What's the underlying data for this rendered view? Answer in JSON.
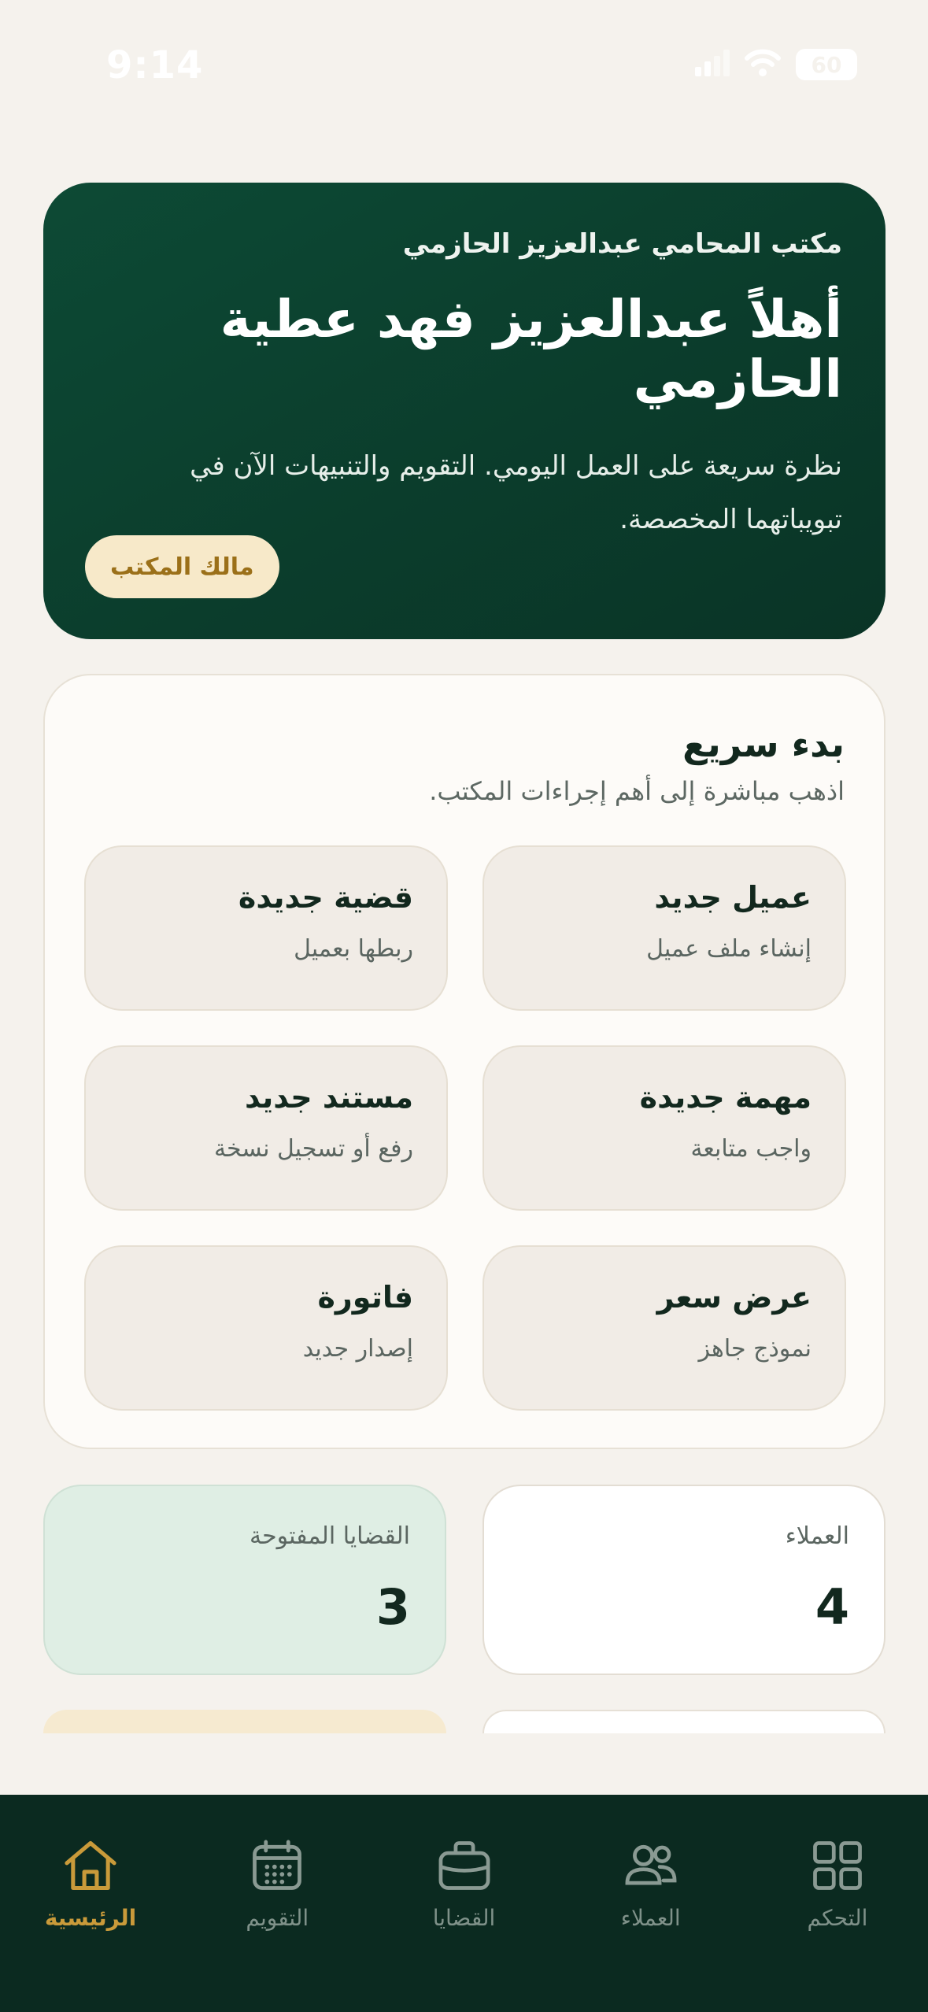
{
  "status_bar": {
    "time": "9:14",
    "battery": "60"
  },
  "hero": {
    "office_name": "مكتب المحامي عبدالعزيز الحازمي",
    "greeting": "أهلاً عبدالعزيز فهد عطية الحازمي",
    "description": "نظرة سريعة على العمل اليومي. التقويم والتنبيهات الآن في تبويباتهما المخصصة.",
    "role_badge": "مالك المكتب"
  },
  "quick_start": {
    "title": "بدء سريع",
    "subtitle": "اذهب مباشرة إلى أهم إجراءات المكتب.",
    "actions": [
      {
        "title": "عميل جديد",
        "subtitle": "إنشاء ملف عميل"
      },
      {
        "title": "قضية جديدة",
        "subtitle": "ربطها بعميل"
      },
      {
        "title": "مهمة جديدة",
        "subtitle": "واجب متابعة"
      },
      {
        "title": "مستند جديد",
        "subtitle": "رفع أو تسجيل نسخة"
      },
      {
        "title": "عرض سعر",
        "subtitle": "نموذج جاهز"
      },
      {
        "title": "فاتورة",
        "subtitle": "إصدار جديد"
      }
    ]
  },
  "stats": {
    "clients": {
      "label": "العملاء",
      "value": "4"
    },
    "open_cases": {
      "label": "القضايا المفتوحة",
      "value": "3"
    }
  },
  "tabbar": {
    "items": [
      {
        "label": "الرئيسية",
        "icon": "home-icon",
        "active": true
      },
      {
        "label": "التقويم",
        "icon": "calendar-icon",
        "active": false
      },
      {
        "label": "القضايا",
        "icon": "briefcase-icon",
        "active": false
      },
      {
        "label": "العملاء",
        "icon": "users-icon",
        "active": false
      },
      {
        "label": "التحكم",
        "icon": "grid-icon",
        "active": false
      }
    ]
  },
  "colors": {
    "hero_bg": "#0d4a35",
    "accent_gold": "#c99a3a",
    "tabbar_bg": "#0b2a20",
    "page_bg": "#f5f2ed"
  }
}
